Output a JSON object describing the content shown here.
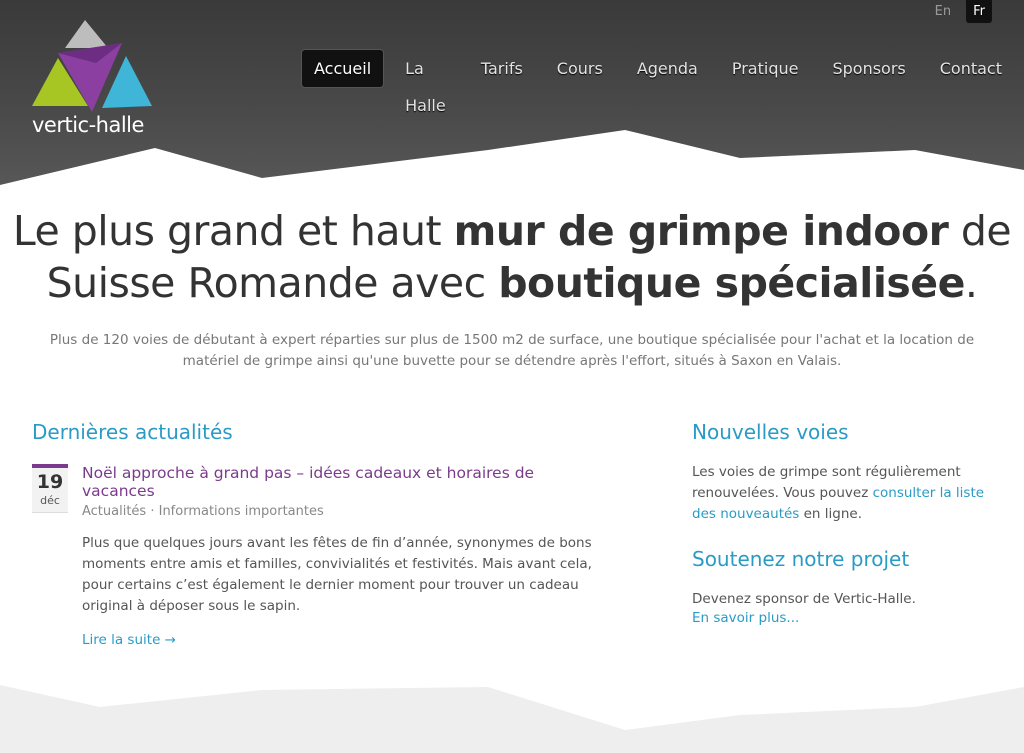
{
  "header": {
    "logo_text": "vertic-halle",
    "languages": [
      {
        "label": "En",
        "active": false
      },
      {
        "label": "Fr",
        "active": true
      }
    ],
    "nav": [
      {
        "label": "Accueil",
        "active": true
      },
      {
        "label": "La Halle",
        "active": false
      },
      {
        "label": "Tarifs",
        "active": false
      },
      {
        "label": "Cours",
        "active": false
      },
      {
        "label": "Agenda",
        "active": false
      },
      {
        "label": "Pratique",
        "active": false
      },
      {
        "label": "Sponsors",
        "active": false
      },
      {
        "label": "Contact",
        "active": false
      }
    ]
  },
  "hero": {
    "line1_a": "Le plus grand et haut ",
    "line1_b": "mur de grimpe indoor",
    "line1_c": " de",
    "line2_a": "Suisse Romande avec ",
    "line2_b": "boutique spécialisée",
    "line2_c": "."
  },
  "intro": "Plus de 120 voies de débutant à expert réparties sur plus de 1500 m2 de surface, une boutique spécialisée pour l'achat et la location de matériel de grimpe ainsi qu'une buvette pour se détendre après l'effort, situés à Saxon en Valais.",
  "news": {
    "heading": "Dernières actualités",
    "post": {
      "day": "19",
      "month": "déc",
      "title": "Noël approche à grand pas – idées cadeaux et horaires de vacances",
      "categories": "Actualités · Informations importantes",
      "excerpt": "Plus que quelques jours avant les fêtes de fin d’année, synonymes de bons moments entre amis et familles, convivialités et festivités. Mais avant cela, pour certains c’est également le dernier moment pour trouver un cadeau original à déposer sous le sapin.",
      "read_more": "Lire la suite →"
    }
  },
  "routes": {
    "heading": "Nouvelles voies",
    "text_a": "Les voies de grimpe sont régulièrement renouvelées. Vous pouvez ",
    "link": "consulter la liste des nouveautés",
    "text_b": " en ligne."
  },
  "support": {
    "heading": "Soutenez notre projet",
    "text": "Devenez sponsor de Vertic-Halle.",
    "link": "En savoir plus..."
  },
  "colors": {
    "accent_blue": "#2a9bc6",
    "accent_purple": "#7b3b8c",
    "header_dark": "#3a3a3a"
  }
}
